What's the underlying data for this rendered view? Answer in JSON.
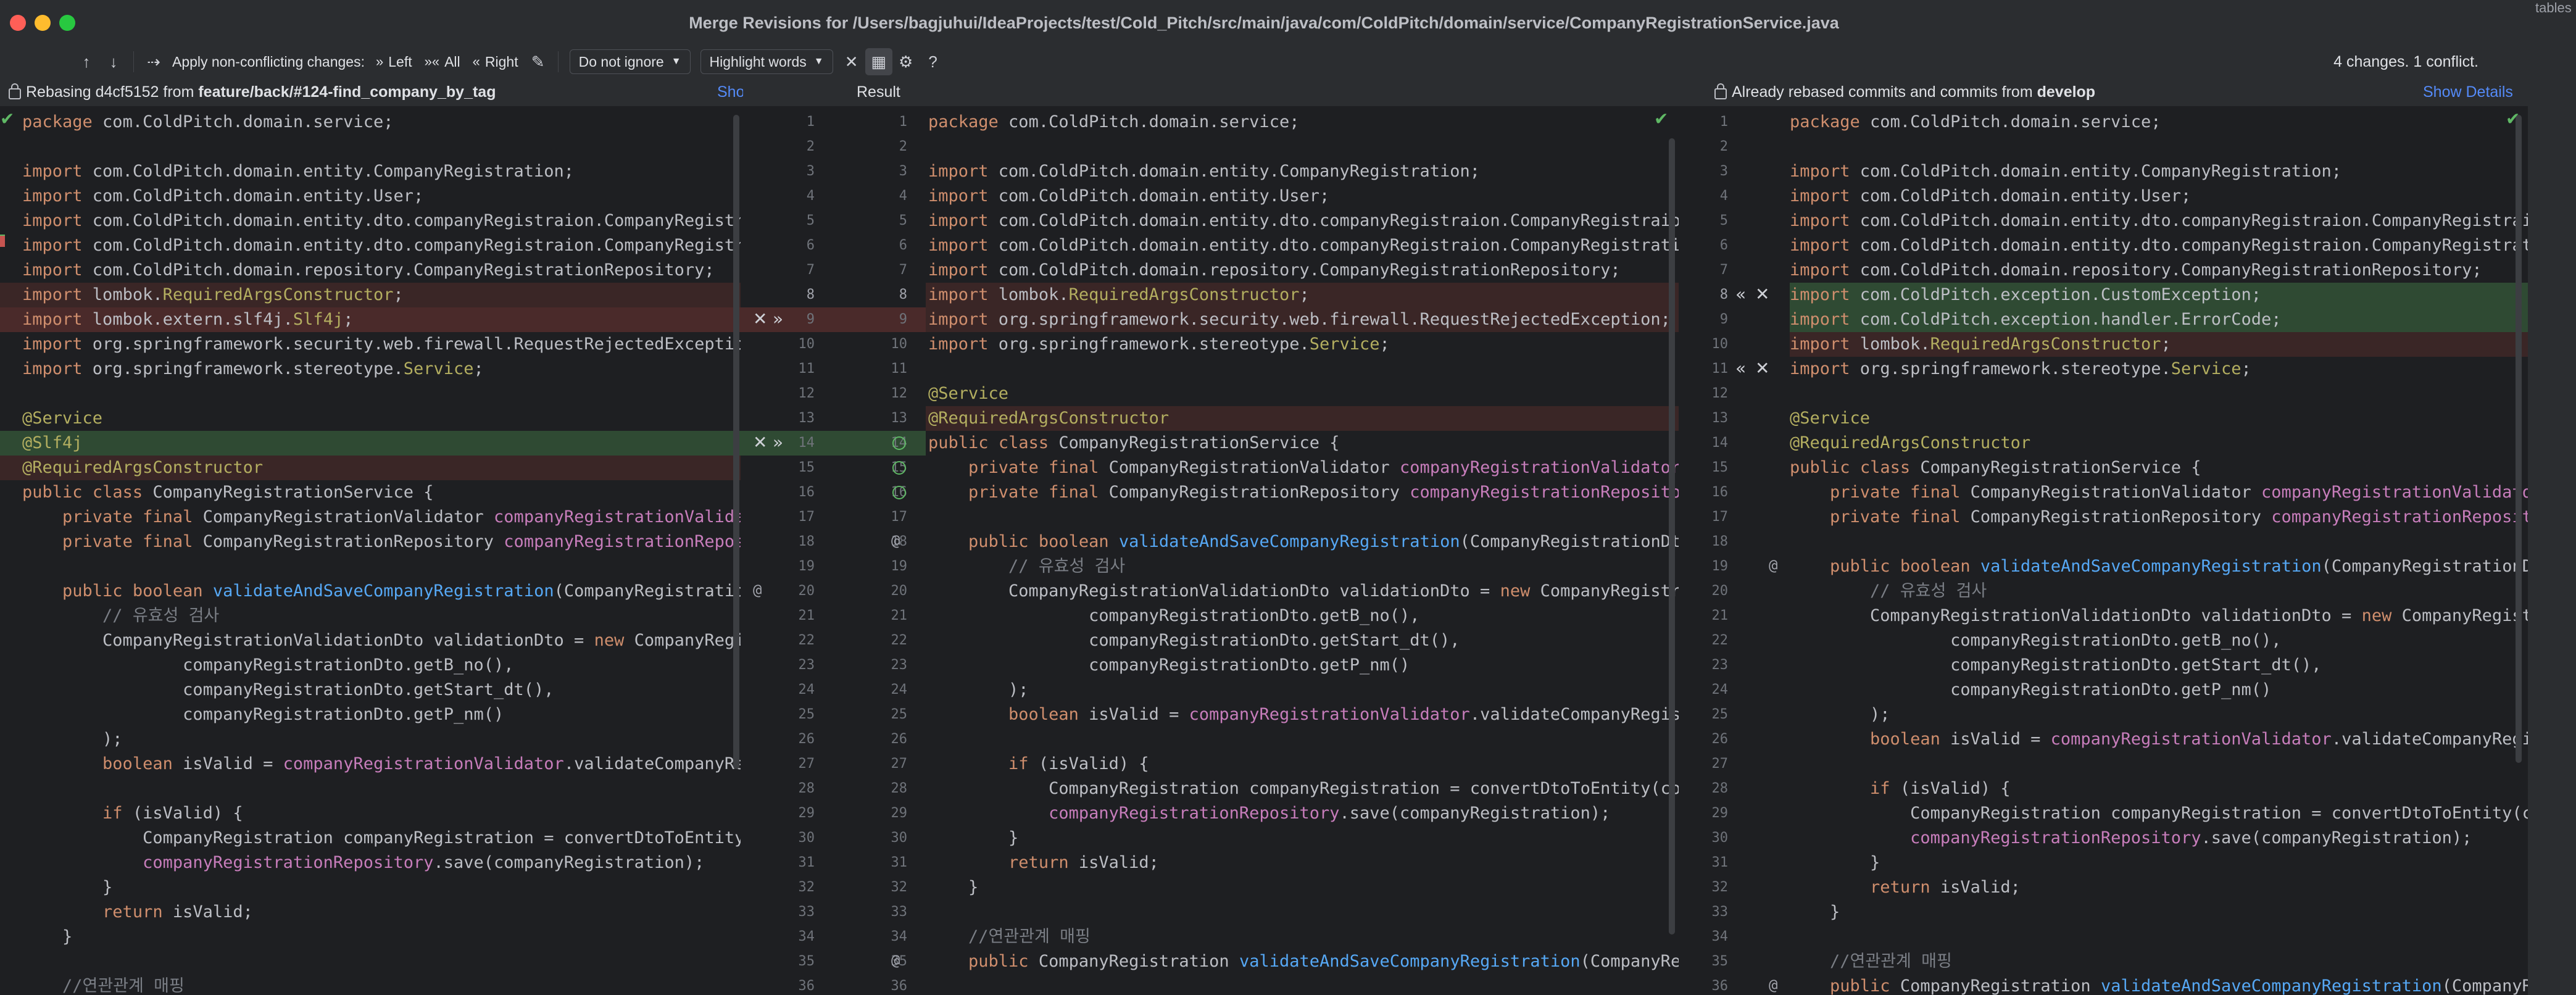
{
  "window": {
    "title": "Merge Revisions for /Users/bagjuhui/IdeaProjects/test/Cold_Pitch/src/main/java/com/ColdPitch/domain/service/CompanyRegistrationService.java",
    "background_fragment": "tables"
  },
  "toolbar": {
    "apply_label": "Apply non-conflicting changes:",
    "left_label": "Left",
    "all_label": "All",
    "right_label": "Right",
    "ignore_select": "Do not ignore",
    "highlight_select": "Highlight words",
    "status": "4 changes. 1 conflict."
  },
  "left_header": {
    "prefix": "Rebasing d4cf5152 from ",
    "branch": "feature/back/#124-find_company_by_tag",
    "show_details": "Show Details"
  },
  "center_header": {
    "title": "Result"
  },
  "right_header": {
    "prefix": "Already rebased commits and commits from ",
    "branch": "develop",
    "show_details": "Show Details"
  },
  "left_lines": [
    "package com.ColdPitch.domain.service;",
    "",
    "import com.ColdPitch.domain.entity.CompanyRegistration;",
    "import com.ColdPitch.domain.entity.User;",
    "import com.ColdPitch.domain.entity.dto.companyRegistraion.CompanyRegistraionDto;",
    "import com.ColdPitch.domain.entity.dto.companyRegistraion.CompanyRegistrationValidationDto;",
    "import com.ColdPitch.domain.repository.CompanyRegistrationRepository;",
    "import lombok.RequiredArgsConstructor;",
    "import lombok.extern.slf4j.Slf4j;",
    "import org.springframework.security.web.firewall.RequestRejectedException;",
    "import org.springframework.stereotype.Service;",
    "",
    "@Service",
    "@Slf4j",
    "@RequiredArgsConstructor",
    "public class CompanyRegistrationService {",
    "    private final CompanyRegistrationValidator companyRegistrationValidator;",
    "    private final CompanyRegistrationRepository companyRegistrationRepository;",
    "",
    "    public boolean validateAndSaveCompanyRegistration(CompanyRegistrationDto companyRegistrationDto) {",
    "        // 유효성 검사",
    "        CompanyRegistrationValidationDto validationDto = new CompanyRegistrationValidationDto(",
    "                companyRegistrationDto.getB_no(),",
    "                companyRegistrationDto.getStart_dt(),",
    "                companyRegistrationDto.getP_nm()",
    "        );",
    "        boolean isValid = companyRegistrationValidator.validateCompanyRegistration(validationDto);",
    "",
    "        if (isValid) {",
    "            CompanyRegistration companyRegistration = convertDtoToEntity(companyRegistrationDto);",
    "            companyRegistrationRepository.save(companyRegistration);",
    "        }",
    "        return isValid;",
    "    }",
    "",
    "    //연관관계 매핑"
  ],
  "result_lines": [
    "package com.ColdPitch.domain.service;",
    "",
    "import com.ColdPitch.domain.entity.CompanyRegistration;",
    "import com.ColdPitch.domain.entity.User;",
    "import com.ColdPitch.domain.entity.dto.companyRegistraion.CompanyRegistraionDto;",
    "import com.ColdPitch.domain.entity.dto.companyRegistraion.CompanyRegistrationValidationDto;",
    "import com.ColdPitch.domain.repository.CompanyRegistrationRepository;",
    "import lombok.RequiredArgsConstructor;",
    "import org.springframework.security.web.firewall.RequestRejectedException;",
    "import org.springframework.stereotype.Service;",
    "",
    "@Service",
    "@RequiredArgsConstructor",
    "public class CompanyRegistrationService {",
    "    private final CompanyRegistrationValidator companyRegistrationValidator;",
    "    private final CompanyRegistrationRepository companyRegistrationRepository;",
    "",
    "    public boolean validateAndSaveCompanyRegistration(CompanyRegistrationDto companyRegistrationDto) {",
    "        // 유효성 검사",
    "        CompanyRegistrationValidationDto validationDto = new CompanyRegistrationValidationDto(",
    "                companyRegistrationDto.getB_no(),",
    "                companyRegistrationDto.getStart_dt(),",
    "                companyRegistrationDto.getP_nm()",
    "        );",
    "        boolean isValid = companyRegistrationValidator.validateCompanyRegistration(validationDto);",
    "",
    "        if (isValid) {",
    "            CompanyRegistration companyRegistration = convertDtoToEntity(companyRegistrationDto);",
    "            companyRegistrationRepository.save(companyRegistration);",
    "        }",
    "        return isValid;",
    "    }",
    "",
    "    //연관관계 매핑",
    "    public CompanyRegistration validateAndSaveCompanyRegistration(CompanyRegistrationDto companyRegistrationDto) {"
  ],
  "right_lines": [
    "package com.ColdPitch.domain.service;",
    "",
    "import com.ColdPitch.domain.entity.CompanyRegistration;",
    "import com.ColdPitch.domain.entity.User;",
    "import com.ColdPitch.domain.entity.dto.companyRegistraion.CompanyRegistraionDto;",
    "import com.ColdPitch.domain.entity.dto.companyRegistraion.CompanyRegistrationValidationDto;",
    "import com.ColdPitch.domain.repository.CompanyRegistrationRepository;",
    "import com.ColdPitch.exception.CustomException;",
    "import com.ColdPitch.exception.handler.ErrorCode;",
    "import lombok.RequiredArgsConstructor;",
    "import org.springframework.stereotype.Service;",
    "",
    "@Service",
    "@RequiredArgsConstructor",
    "public class CompanyRegistrationService {",
    "    private final CompanyRegistrationValidator companyRegistrationValidator;",
    "    private final CompanyRegistrationRepository companyRegistrationRepository;",
    "",
    "    public boolean validateAndSaveCompanyRegistration(CompanyRegistrationDto companyRegistrationDto) {",
    "        // 유효성 검사",
    "        CompanyRegistrationValidationDto validationDto = new CompanyRegistrationValidationDto(",
    "                companyRegistrationDto.getB_no(),",
    "                companyRegistrationDto.getStart_dt(),",
    "                companyRegistrationDto.getP_nm()",
    "        );",
    "        boolean isValid = companyRegistrationValidator.validateCompanyRegistration(validationDto);",
    "",
    "        if (isValid) {",
    "            CompanyRegistration companyRegistration = convertDtoToEntity(companyRegistrationDto);",
    "            companyRegistrationRepository.save(companyRegistration);",
    "        }",
    "        return isValid;",
    "    }",
    "",
    "    //연관관계 매핑",
    "    public CompanyRegistration validateAndSaveCompanyRegistration(CompanyRegistrationDto companyRegistrationDto) {"
  ],
  "gutter": {
    "left_result": [
      "1",
      "2",
      "3",
      "4",
      "5",
      "6",
      "7",
      "8",
      "9",
      "10",
      "11",
      "12",
      "13",
      "14",
      "15",
      "16",
      "17",
      "18",
      "19",
      "20",
      "21",
      "22",
      "23",
      "24",
      "25",
      "26",
      "27",
      "28",
      "29",
      "30",
      "31",
      "32",
      "33",
      "34",
      "35",
      "36"
    ],
    "result": [
      "1",
      "2",
      "3",
      "4",
      "5",
      "6",
      "7",
      "8",
      "9",
      "10",
      "11",
      "12",
      "13",
      "14",
      "15",
      "16",
      "17",
      "18",
      "19",
      "20",
      "21",
      "22",
      "23",
      "24",
      "25",
      "26",
      "27",
      "28",
      "29",
      "30",
      "31",
      "32",
      "33",
      "34",
      "35",
      "36"
    ],
    "right": [
      "1",
      "2",
      "3",
      "4",
      "5",
      "6",
      "7",
      "8",
      "9",
      "10",
      "11",
      "12",
      "13",
      "14",
      "15",
      "16",
      "17",
      "18",
      "19",
      "20",
      "21",
      "22",
      "23",
      "24",
      "25",
      "26",
      "27",
      "28",
      "29",
      "30",
      "31",
      "32",
      "33",
      "34",
      "35",
      "36"
    ]
  },
  "colors": {
    "accent_link": "#548af7",
    "added": "#2f4a33",
    "conflict": "#4a2a2a",
    "keyword": "#cf8e6d",
    "annotation": "#b3ae60",
    "method": "#56a8f5",
    "field": "#c77dbb",
    "comment": "#7a7e85"
  },
  "icons": {
    "toolbar": [
      "prev-difference-icon",
      "next-difference-icon",
      "magic-resolve-icon",
      "apply-left-icon",
      "apply-all-icon",
      "apply-right-icon",
      "magic-wand-icon",
      "close-icon",
      "collapse-icon",
      "settings-icon",
      "help-icon"
    ],
    "gutter": [
      "accept-icon",
      "reject-icon",
      "annotate-icon",
      "implementation-icon"
    ]
  }
}
